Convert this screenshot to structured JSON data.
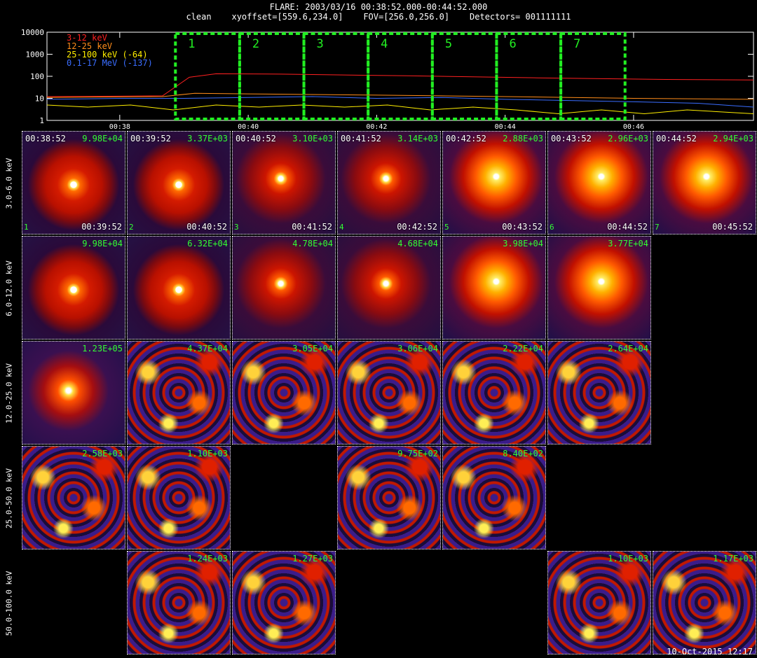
{
  "header": {
    "line1": "FLARE: 2003/03/16 00:38:52.000-00:44:52.000",
    "line2": "clean    xyoffset=[559.6,234.0]    FOV=[256.0,256.0]    Detectors= 001111111"
  },
  "chart_data": {
    "type": "line",
    "yscale": "log",
    "ylim": [
      1,
      10000
    ],
    "ytick_labels": [
      "1",
      "10",
      "100",
      "1000",
      "10000"
    ],
    "xlim": [
      "00:36:52",
      "00:47:52"
    ],
    "xtick_labels": [
      "00:38",
      "00:40",
      "00:42",
      "00:44",
      "00:46"
    ],
    "legend_position": "top-left",
    "series": [
      {
        "name": "3-12 keV",
        "color": "#ff2020",
        "t": [
          "00:36:52",
          "00:38:40",
          "00:39:05",
          "00:39:30",
          "00:40:30",
          "00:41:30",
          "00:42:30",
          "00:43:30",
          "00:44:30",
          "00:45:30",
          "00:46:30",
          "00:47:52"
        ],
        "values": [
          12,
          13,
          90,
          130,
          125,
          115,
          105,
          95,
          85,
          78,
          72,
          68
        ]
      },
      {
        "name": "12-25 keV",
        "color": "#ff8c1a",
        "t": [
          "00:36:52",
          "00:38:40",
          "00:39:10",
          "00:40:00",
          "00:41:00",
          "00:42:00",
          "00:43:00",
          "00:44:00",
          "00:45:00",
          "00:46:00",
          "00:47:52"
        ],
        "values": [
          11,
          12,
          17,
          16,
          15,
          14,
          13,
          12,
          11,
          10,
          9
        ]
      },
      {
        "name": "25-100 keV (-64)",
        "color": "#ffee00",
        "t": [
          "00:36:52",
          "00:37:30",
          "00:38:10",
          "00:38:50",
          "00:39:30",
          "00:40:10",
          "00:40:50",
          "00:41:30",
          "00:42:10",
          "00:42:50",
          "00:43:30",
          "00:44:10",
          "00:44:50",
          "00:45:30",
          "00:46:10",
          "00:46:50",
          "00:47:52"
        ],
        "values": [
          5,
          4,
          5,
          3,
          5,
          4,
          5,
          4,
          5,
          3,
          4,
          3,
          2,
          3,
          2,
          3,
          2
        ]
      },
      {
        "name": "0.1-17 MeV (-137)",
        "color": "#3a6dff",
        "t": [
          "00:36:52",
          "00:38:00",
          "00:39:00",
          "00:40:00",
          "00:41:00",
          "00:42:00",
          "00:43:00",
          "00:44:00",
          "00:45:00",
          "00:46:00",
          "00:47:00",
          "00:47:52"
        ],
        "values": [
          9,
          10,
          10,
          11,
          12,
          10,
          11,
          9,
          8,
          7,
          6,
          4
        ]
      }
    ],
    "intervals": [
      {
        "label": "1",
        "start": "00:38:52",
        "end": "00:39:52"
      },
      {
        "label": "2",
        "start": "00:39:52",
        "end": "00:40:52"
      },
      {
        "label": "3",
        "start": "00:40:52",
        "end": "00:41:52"
      },
      {
        "label": "4",
        "start": "00:41:52",
        "end": "00:42:52"
      },
      {
        "label": "5",
        "start": "00:42:52",
        "end": "00:43:52"
      },
      {
        "label": "6",
        "start": "00:43:52",
        "end": "00:44:52"
      },
      {
        "label": "7",
        "start": "00:44:52",
        "end": "00:45:52"
      }
    ],
    "interval_color": "#22ee22"
  },
  "row_labels": [
    "3.0-6.0 keV",
    "6.0-12.0 keV",
    "12.0-25.0 keV",
    "25.0-50.0 keV",
    "50.0-100.0 keV"
  ],
  "tiles": [
    {
      "row": 0,
      "col": 0,
      "start": "00:38:52",
      "end": "00:39:52",
      "max": "9.98E+04",
      "index": "1",
      "style": "disk"
    },
    {
      "row": 0,
      "col": 1,
      "start": "00:39:52",
      "end": "00:40:52",
      "max": "3.37E+03",
      "index": "2",
      "style": "disk"
    },
    {
      "row": 0,
      "col": 2,
      "start": "00:40:52",
      "end": "00:41:52",
      "max": "3.10E+03",
      "index": "3",
      "style": "disk-rough"
    },
    {
      "row": 0,
      "col": 3,
      "start": "00:41:52",
      "end": "00:42:52",
      "max": "3.14E+03",
      "index": "4",
      "style": "disk-rough"
    },
    {
      "row": 0,
      "col": 4,
      "start": "00:42:52",
      "end": "00:43:52",
      "max": "2.88E+03",
      "index": "5",
      "style": "bright"
    },
    {
      "row": 0,
      "col": 5,
      "start": "00:43:52",
      "end": "00:44:52",
      "max": "2.96E+03",
      "index": "6",
      "style": "bright"
    },
    {
      "row": 0,
      "col": 6,
      "start": "00:44:52",
      "end": "00:45:52",
      "max": "2.94E+03",
      "index": "7",
      "style": "bright"
    },
    {
      "row": 1,
      "col": 0,
      "max": "9.98E+04",
      "style": "disk"
    },
    {
      "row": 1,
      "col": 1,
      "max": "6.32E+04",
      "style": "disk"
    },
    {
      "row": 1,
      "col": 2,
      "max": "4.78E+04",
      "style": "disk-rough"
    },
    {
      "row": 1,
      "col": 3,
      "max": "4.68E+04",
      "style": "disk-rough"
    },
    {
      "row": 1,
      "col": 4,
      "max": "3.98E+04",
      "style": "bright"
    },
    {
      "row": 1,
      "col": 5,
      "max": "3.77E+04",
      "style": "bright"
    },
    {
      "row": 2,
      "col": 0,
      "max": "1.23E+05",
      "style": "source"
    },
    {
      "row": 2,
      "col": 1,
      "max": "4.37E+04",
      "style": "noise"
    },
    {
      "row": 2,
      "col": 2,
      "max": "3.05E+04",
      "style": "noise"
    },
    {
      "row": 2,
      "col": 3,
      "max": "3.06E+04",
      "style": "noise"
    },
    {
      "row": 2,
      "col": 4,
      "max": "2.22E+04",
      "style": "noise"
    },
    {
      "row": 2,
      "col": 5,
      "max": "2.64E+04",
      "style": "noise"
    },
    {
      "row": 3,
      "col": 0,
      "max": "2.58E+03",
      "style": "noise"
    },
    {
      "row": 3,
      "col": 1,
      "max": "1.10E+03",
      "style": "noise"
    },
    {
      "row": 3,
      "col": 3,
      "max": "9.75E+02",
      "style": "noise"
    },
    {
      "row": 3,
      "col": 4,
      "max": "8.40E+02",
      "style": "noise"
    },
    {
      "row": 4,
      "col": 1,
      "max": "1.24E+03",
      "style": "noise"
    },
    {
      "row": 4,
      "col": 2,
      "max": "1.27E+03",
      "style": "noise"
    },
    {
      "row": 4,
      "col": 5,
      "max": "1.10E+03",
      "style": "noise"
    },
    {
      "row": 4,
      "col": 6,
      "max": "1.17E+03",
      "style": "noise"
    }
  ],
  "footer": {
    "stamp": "10-Oct-2015 12:17"
  }
}
